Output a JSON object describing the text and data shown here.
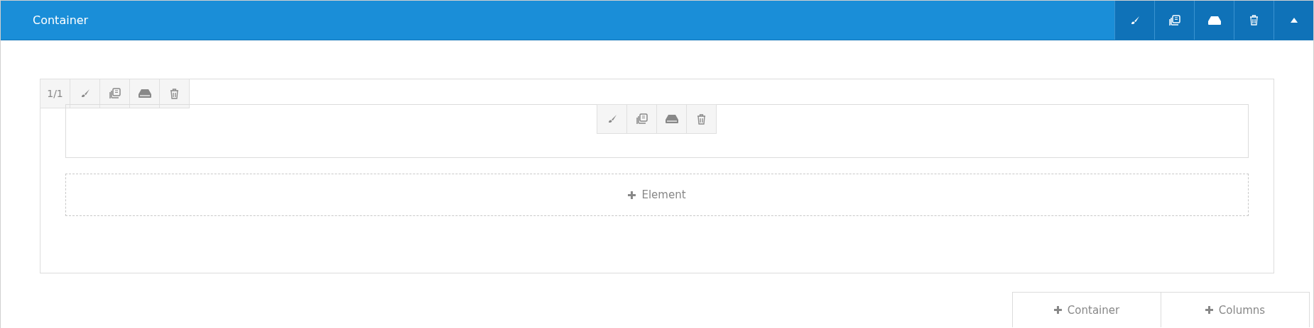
{
  "header": {
    "title": "Container"
  },
  "column": {
    "label": "1/1"
  },
  "add_element": {
    "label": "Element"
  },
  "bottom_buttons": [
    {
      "label": "Container"
    },
    {
      "label": "Columns"
    }
  ]
}
